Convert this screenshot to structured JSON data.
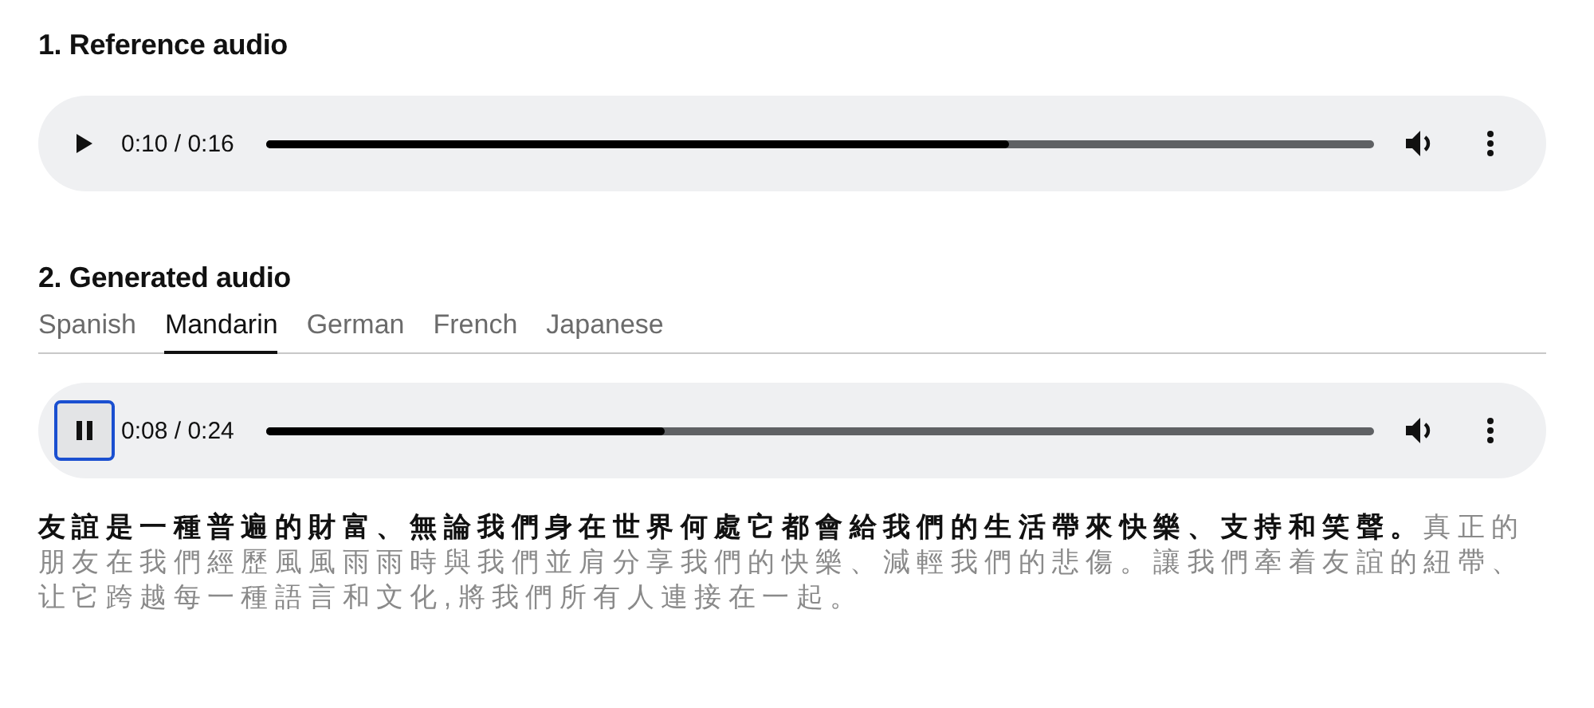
{
  "reference": {
    "heading": "1. Reference audio",
    "player": {
      "playing": false,
      "focused": false,
      "time": "0:10 / 0:16",
      "level": 0.67
    }
  },
  "generated": {
    "heading": "2. Generated audio",
    "tabs": [
      {
        "label": "Spanish",
        "selected": false
      },
      {
        "label": "Mandarin",
        "selected": true
      },
      {
        "label": "German",
        "selected": false
      },
      {
        "label": "French",
        "selected": false
      },
      {
        "label": "Japanese",
        "selected": false
      }
    ],
    "player": {
      "playing": true,
      "focused": true,
      "time": "0:08 / 0:24",
      "level": 0.36
    },
    "transcript": [
      {
        "text": "友誼是一種普遍的財富、無論我們身在世界何處它都會給我們的生活帶來快樂、支持和笑聲。",
        "spoken": true
      },
      {
        "text": "真正的朋友在我們經歷風風雨雨時與我們並肩分享我們的快樂、減輕我們的悲傷。",
        "spoken": false
      },
      {
        "text": "讓我們牽着友誼的紐帶、让它跨越每一種語言和文化,將我們所有人連接在一起。",
        "spoken": false
      }
    ]
  }
}
